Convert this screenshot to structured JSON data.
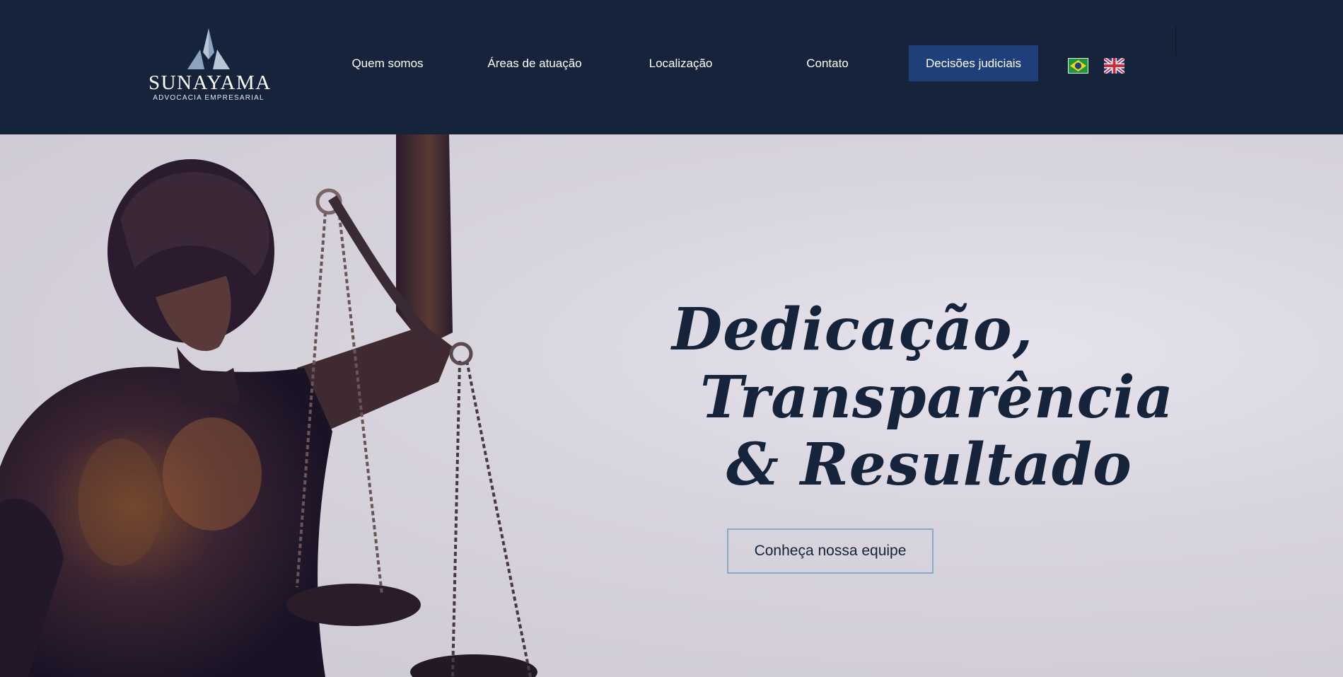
{
  "brand": {
    "name": "SUNAYAMA",
    "tagline": "ADVOCACIA EMPRESARIAL"
  },
  "nav": {
    "items": [
      {
        "label": "Quem somos"
      },
      {
        "label": "Áreas de atuação"
      },
      {
        "label": "Localização"
      },
      {
        "label": "Contato"
      }
    ],
    "cta_label": "Decisões judiciais"
  },
  "languages": [
    {
      "icon": "brazil-flag-icon"
    },
    {
      "icon": "uk-flag-icon"
    }
  ],
  "hero": {
    "line1": "Dedicação,",
    "line2": "Transparência",
    "line3": "& Resultado",
    "button_label": "Conheça nossa equipe"
  },
  "colors": {
    "header_bg": "#15233b",
    "cta_bg": "#1f3f7a",
    "headline": "#15233b",
    "button_border": "#8aaac8"
  }
}
